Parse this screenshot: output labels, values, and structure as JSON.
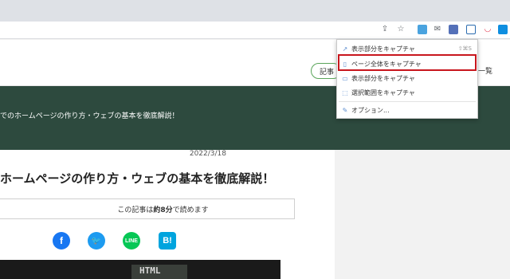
{
  "site": {
    "nav_pill_label": "記事",
    "nav_right_label": "一覧",
    "banner_text": "でのホームページの作り方・ウェブの基本を徹底解説！"
  },
  "article": {
    "date": "2022/3/18",
    "title": "ホームページの作り方・ウェブの基本を徹底解説！",
    "read_prefix": "この記事は",
    "read_time": "約8分",
    "read_suffix": "で読めます",
    "share": {
      "hatena": "B!"
    },
    "photo_text": "HTML"
  },
  "menu": {
    "items": [
      {
        "label": "表示部分をキャプチャ",
        "shortcut": "⇧⌘S"
      },
      {
        "label": "ページ全体をキャプチャ"
      },
      {
        "label": "表示部分をキャプチャ"
      },
      {
        "label": "選択範囲をキャプチャ"
      },
      {
        "label": "オプション..."
      }
    ]
  },
  "colors": {
    "banner": "#2d4a3e",
    "highlight": "#c8161d",
    "facebook": "#1877f2",
    "twitter": "#1d9bf0",
    "line": "#06c755",
    "hatena": "#00a4de"
  }
}
